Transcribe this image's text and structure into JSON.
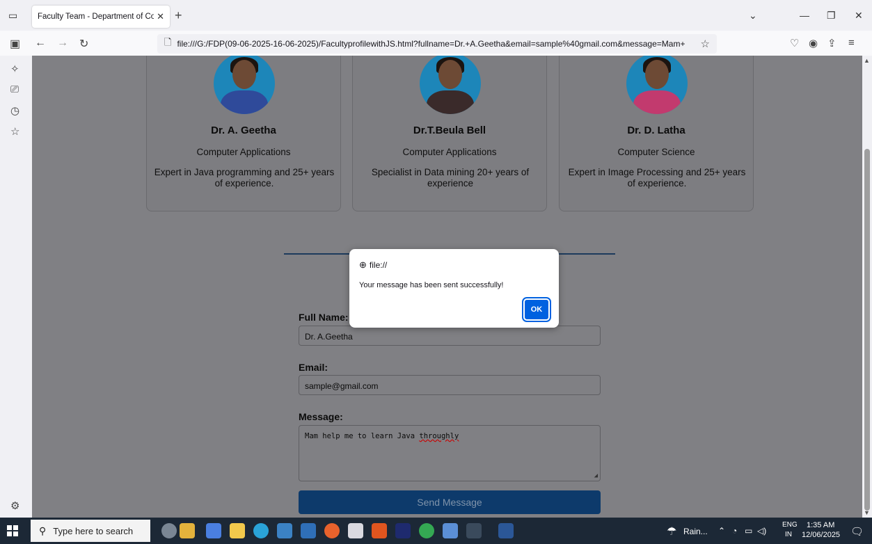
{
  "browser": {
    "tab_title": "Faculty Team - Department of Comp",
    "url": "file:///G:/FDP(09-06-2025-16-06-2025)/FacultyprofilewithJS.html?fullname=Dr.+A.Geetha&email=sample%40gmail.com&message=Mam+"
  },
  "faculty": [
    {
      "name": "Dr. A. Geetha",
      "dept": "Computer Applications",
      "desc": "Expert in Java programming and 25+ years of experience."
    },
    {
      "name": "Dr.T.Beula Bell",
      "dept": "Computer Applications",
      "desc": "Specialist in Data mining 20+ years of experience"
    },
    {
      "name": "Dr. D. Latha",
      "dept": "Computer Science",
      "desc": "Expert in Image Processing and 25+ years of experience."
    }
  ],
  "form": {
    "fullname_label": "Full Name:",
    "fullname_value": "Dr. A.Geetha",
    "email_label": "Email:",
    "email_value": "sample@gmail.com",
    "message_label": "Message:",
    "message_value_prefix": "Mam help me to learn Java ",
    "message_value_misspelled": "throughly",
    "send_label": "Send Message"
  },
  "dialog": {
    "origin": "file://",
    "message": "Your message has been sent successfully!",
    "ok_label": "OK"
  },
  "taskbar": {
    "search_placeholder": "Type here to search",
    "weather": "Rain...",
    "lang_top": "ENG",
    "lang_bottom": "IN",
    "time": "1:35 AM",
    "date": "12/06/2025"
  },
  "icons": {
    "tab_list": "tab-list-icon",
    "back": "back-arrow-icon",
    "forward": "forward-arrow-icon",
    "reload": "reload-icon",
    "star": "bookmark-star-icon",
    "pocket": "pocket-icon",
    "account": "account-icon",
    "extensions": "extensions-icon",
    "menu": "hamburger-menu-icon"
  }
}
